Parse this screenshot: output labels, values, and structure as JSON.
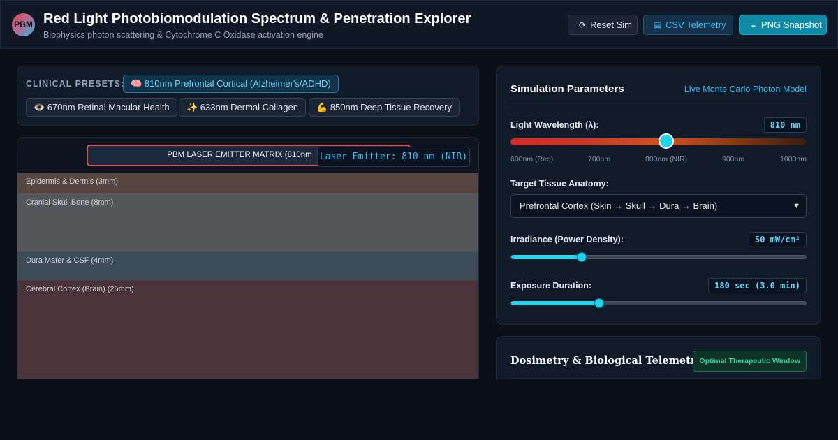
{
  "header": {
    "logo": "PBM",
    "title": "Red Light Photobiomodulation Spectrum & Penetration Explorer",
    "subtitle": "Biophysics photon scattering & Cytochrome C Oxidase activation engine",
    "buttons": {
      "reset": {
        "label": "Reset Sim",
        "icon": "refresh-icon",
        "glyph": "⟳"
      },
      "csv": {
        "label": "CSV Telemetry",
        "icon": "file-icon",
        "glyph": "▤"
      },
      "png": {
        "label": "PNG Snapshot",
        "icon": "camera-icon",
        "glyph": "◒"
      }
    }
  },
  "presets": {
    "label": "CLINICAL PRESETS:",
    "items": [
      {
        "label": "🧠 810nm Prefrontal Cortical (Alzheimer's/ADHD)",
        "active": true
      },
      {
        "label": "👁️ 670nm Retinal Macular Health",
        "active": false
      },
      {
        "label": "✨ 633nm Dermal Collagen",
        "active": false
      },
      {
        "label": "💪 850nm Deep Tissue Recovery",
        "active": false
      }
    ]
  },
  "tissue": {
    "emitter_label": "PBM LASER EMITTER MATRIX (810nm",
    "emitter_tag": "Laser Emitter: 810 nm (NIR)",
    "layers": [
      {
        "label": "Epidermis & Dermis (3mm)"
      },
      {
        "label": "Cranial Skull Bone (8mm)"
      },
      {
        "label": "Dura Mater & CSF (4mm)"
      },
      {
        "label": "Cerebral Cortex (Brain) (25mm)"
      }
    ]
  },
  "params": {
    "title": "Simulation Parameters",
    "tag": "Live Monte Carlo Photon Model",
    "wavelength": {
      "label": "Light Wavelength (λ):",
      "value_text": "810 nm",
      "value": 810,
      "min": 600,
      "max": 1000,
      "ticks": [
        "600nm (Red)",
        "700nm",
        "800nm (NIR)",
        "900nm",
        "1000nm"
      ]
    },
    "tissue_select": {
      "label": "Target Tissue Anatomy:",
      "selected": "Prefrontal Cortex (Skin → Skull → Dura → Brain)"
    },
    "irradiance": {
      "label": "Irradiance (Power Density):",
      "value_text": "50 mW/cm²",
      "fraction": 0.24
    },
    "duration": {
      "label": "Exposure Duration:",
      "value_text": "180 sec (3.0 min)",
      "fraction": 0.3
    }
  },
  "dosimetry": {
    "title": "Dosimetry & Biological Telemetry",
    "badge": "Optimal Therapeutic Window"
  },
  "colors": {
    "accent": "#22d3ee",
    "background": "#0b1018",
    "panel": "#111a28",
    "emitter_border": "#e05252",
    "success": "#34d399"
  }
}
